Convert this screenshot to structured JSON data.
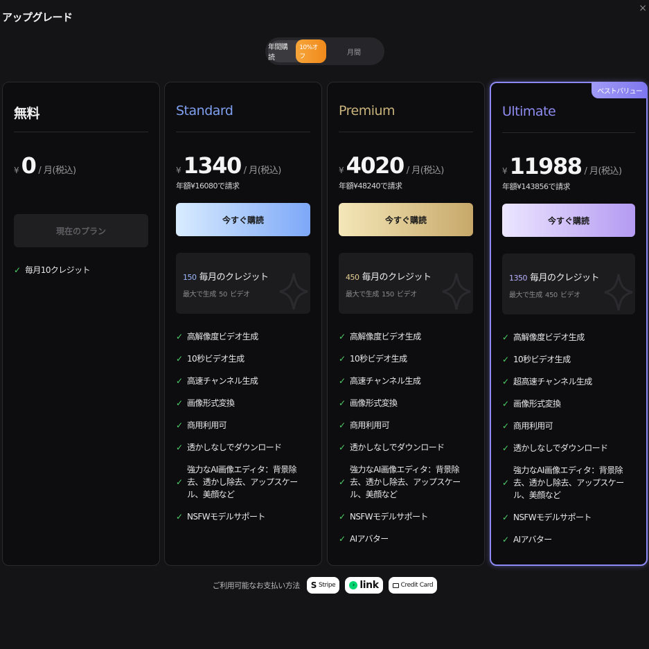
{
  "header": {
    "title": "アップグレード",
    "close": "×"
  },
  "billing": {
    "yearly_label": "年間購読",
    "discount_badge": "10%オフ",
    "monthly_label": "月間"
  },
  "plans": [
    {
      "name": "無料",
      "name_color": "#f2f2f2",
      "yen": "¥",
      "price": "0",
      "unit": "/ 月(税込)",
      "annual": "",
      "cta": "現在のプラン",
      "features": [
        "毎月10クレジット"
      ]
    },
    {
      "name": "Standard",
      "name_color": "#7f9ff0",
      "yen": "¥",
      "price": "1340",
      "unit": "/ 月(税込)",
      "annual": "年額¥16080で請求",
      "cta": "今すぐ購読",
      "credit": {
        "amount": "150",
        "amount_color": "#9db8ff",
        "label": "毎月のクレジット",
        "sub_prefix": "最大で生成",
        "videos": "50",
        "sub_suffix": "ビデオ"
      },
      "features": [
        "高解像度ビデオ生成",
        "10秒ビデオ生成",
        "高速チャンネル生成",
        "画像形式変換",
        "商用利用可",
        "透かしなしでダウンロード",
        "強力なAI画像エディタ：背景除去、透かし除去、アップスケール、美顔など",
        "NSFWモデルサポート"
      ]
    },
    {
      "name": "Premium",
      "name_color": "#c9b37c",
      "yen": "¥",
      "price": "4020",
      "unit": "/ 月(税込)",
      "annual": "年額¥48240で請求",
      "cta": "今すぐ購読",
      "credit": {
        "amount": "450",
        "amount_color": "#e6cf93",
        "label": "毎月のクレジット",
        "sub_prefix": "最大で生成",
        "videos": "150",
        "sub_suffix": "ビデオ"
      },
      "features": [
        "高解像度ビデオ生成",
        "10秒ビデオ生成",
        "高速チャンネル生成",
        "画像形式変換",
        "商用利用可",
        "透かしなしでダウンロード",
        "強力なAI画像エディタ：背景除去、透かし除去、アップスケール、美顔など",
        "NSFWモデルサポート",
        "AIアバター"
      ]
    },
    {
      "name": "Ultimate",
      "name_color": "#8f8cf0",
      "yen": "¥",
      "price": "11988",
      "unit": "/ 月(税込)",
      "annual": "年額¥143856で請求",
      "cta": "今すぐ購読",
      "badge": "ベストバリュー",
      "credit": {
        "amount": "1350",
        "amount_color": "#b9b2ff",
        "label": "毎月のクレジット",
        "sub_prefix": "最大で生成",
        "videos": "450",
        "sub_suffix": "ビデオ"
      },
      "features": [
        "高解像度ビデオ生成",
        "10秒ビデオ生成",
        "超高速チャンネル生成",
        "画像形式変換",
        "商用利用可",
        "透かしなしでダウンロード",
        "強力なAI画像エディタ：背景除去、透かし除去、アップスケール、美顔など",
        "NSFWモデルサポート",
        "AIアバター"
      ]
    }
  ],
  "payment": {
    "label": "ご利用可能なお支払い方法",
    "stripe": "Stripe",
    "link": "link",
    "card": "Credit Card"
  },
  "icons": {
    "check": "check-icon",
    "sparkle": "sparkle-icon",
    "close": "close-icon"
  }
}
